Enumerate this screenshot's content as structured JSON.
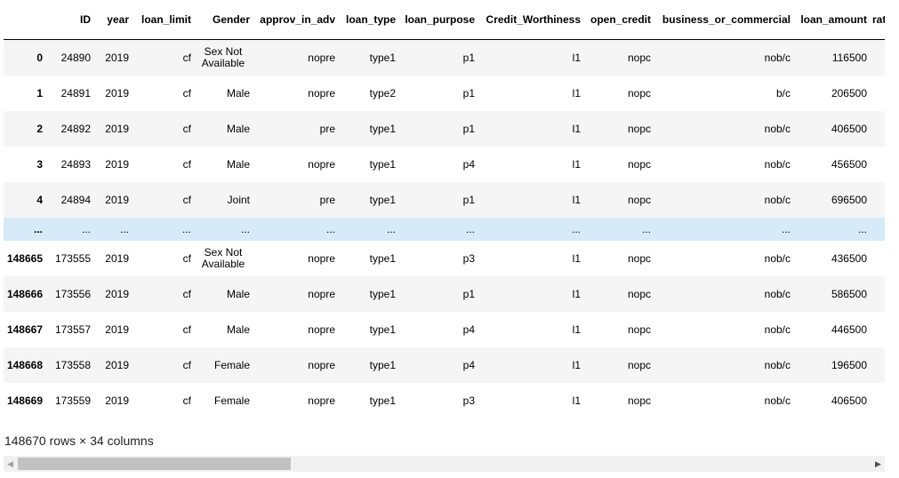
{
  "table": {
    "columns": [
      "",
      "ID",
      "year",
      "loan_limit",
      "Gender",
      "approv_in_adv",
      "loan_type",
      "loan_purpose",
      "Credit_Worthiness",
      "open_credit",
      "business_or_commercial",
      "loan_amount",
      "rate_of_interest"
    ],
    "rows": [
      {
        "index": "0",
        "cells": [
          "24890",
          "2019",
          "cf",
          "Sex Not Available",
          "nopre",
          "type1",
          "p1",
          "l1",
          "nopc",
          "nob/c",
          "116500"
        ]
      },
      {
        "index": "1",
        "cells": [
          "24891",
          "2019",
          "cf",
          "Male",
          "nopre",
          "type2",
          "p1",
          "l1",
          "nopc",
          "b/c",
          "206500"
        ]
      },
      {
        "index": "2",
        "cells": [
          "24892",
          "2019",
          "cf",
          "Male",
          "pre",
          "type1",
          "p1",
          "l1",
          "nopc",
          "nob/c",
          "406500"
        ]
      },
      {
        "index": "3",
        "cells": [
          "24893",
          "2019",
          "cf",
          "Male",
          "nopre",
          "type1",
          "p4",
          "l1",
          "nopc",
          "nob/c",
          "456500"
        ]
      },
      {
        "index": "4",
        "cells": [
          "24894",
          "2019",
          "cf",
          "Joint",
          "pre",
          "type1",
          "p1",
          "l1",
          "nopc",
          "nob/c",
          "696500"
        ]
      },
      {
        "index": "...",
        "cells": [
          "...",
          "...",
          "...",
          "...",
          "...",
          "...",
          "...",
          "...",
          "...",
          "...",
          "..."
        ],
        "ellipsis": true
      },
      {
        "index": "148665",
        "cells": [
          "173555",
          "2019",
          "cf",
          "Sex Not Available",
          "nopre",
          "type1",
          "p3",
          "l1",
          "nopc",
          "nob/c",
          "436500"
        ]
      },
      {
        "index": "148666",
        "cells": [
          "173556",
          "2019",
          "cf",
          "Male",
          "nopre",
          "type1",
          "p1",
          "l1",
          "nopc",
          "nob/c",
          "586500"
        ]
      },
      {
        "index": "148667",
        "cells": [
          "173557",
          "2019",
          "cf",
          "Male",
          "nopre",
          "type1",
          "p4",
          "l1",
          "nopc",
          "nob/c",
          "446500"
        ]
      },
      {
        "index": "148668",
        "cells": [
          "173558",
          "2019",
          "cf",
          "Female",
          "nopre",
          "type1",
          "p4",
          "l1",
          "nopc",
          "nob/c",
          "196500"
        ]
      },
      {
        "index": "148669",
        "cells": [
          "173559",
          "2019",
          "cf",
          "Female",
          "nopre",
          "type1",
          "p3",
          "l1",
          "nopc",
          "nob/c",
          "406500"
        ]
      }
    ]
  },
  "shape_text": "148670 rows × 34 columns",
  "scrollbar": {
    "left_arrow_icon": "triangle-left-icon",
    "right_arrow_icon": "triangle-right-icon",
    "position_fraction": 0.0,
    "visible_fraction": 0.32
  },
  "colors": {
    "odd_row": "#f5f5f5",
    "ellipsis_row": "#d6eaf8",
    "scroll_track": "#f1f1f1",
    "scroll_thumb": "#c1c1c1"
  }
}
